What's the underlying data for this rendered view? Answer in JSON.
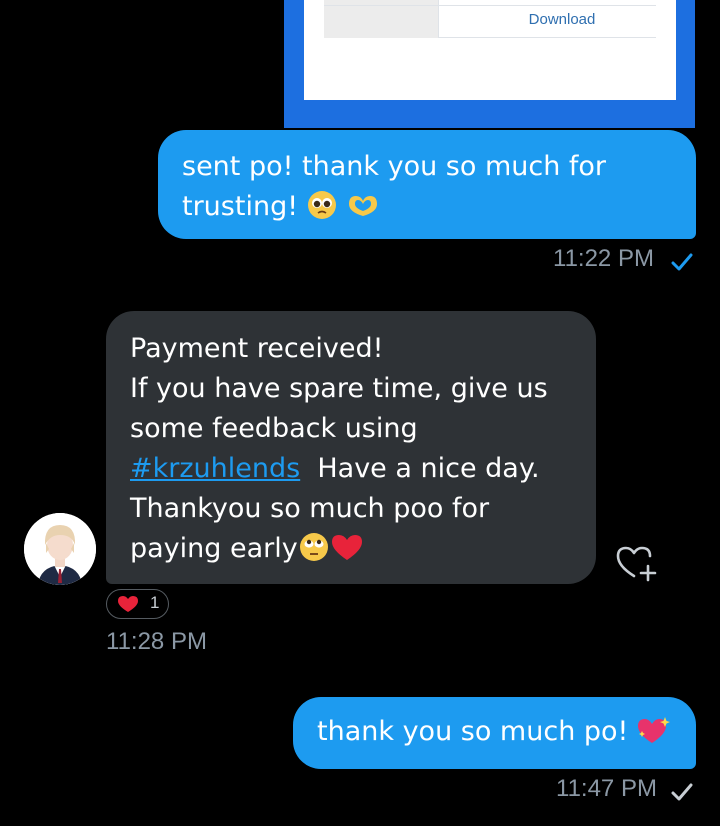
{
  "receipt": {
    "download_label": "Download"
  },
  "messages": {
    "m1": {
      "line1": "sent po! thank you so much for",
      "line2": "trusting!",
      "time": "11:22 PM"
    },
    "m2": {
      "lines": [
        "Payment received!",
        "If you have spare time, give us",
        "some feedback using"
      ],
      "hashtag": "#krzuhlends",
      "after_hashtag": "Have a nice day.",
      "line5": "Thankyou so much poo for",
      "line6": "paying early",
      "time": "11:28 PM",
      "reaction_count": "1"
    },
    "m3": {
      "text": "thank you so much po!",
      "time": "11:47 PM"
    }
  },
  "colors": {
    "outgoing": "#1d9bf0",
    "incoming": "#2e3236",
    "timestamp": "#8b98a5",
    "background": "#000000"
  }
}
